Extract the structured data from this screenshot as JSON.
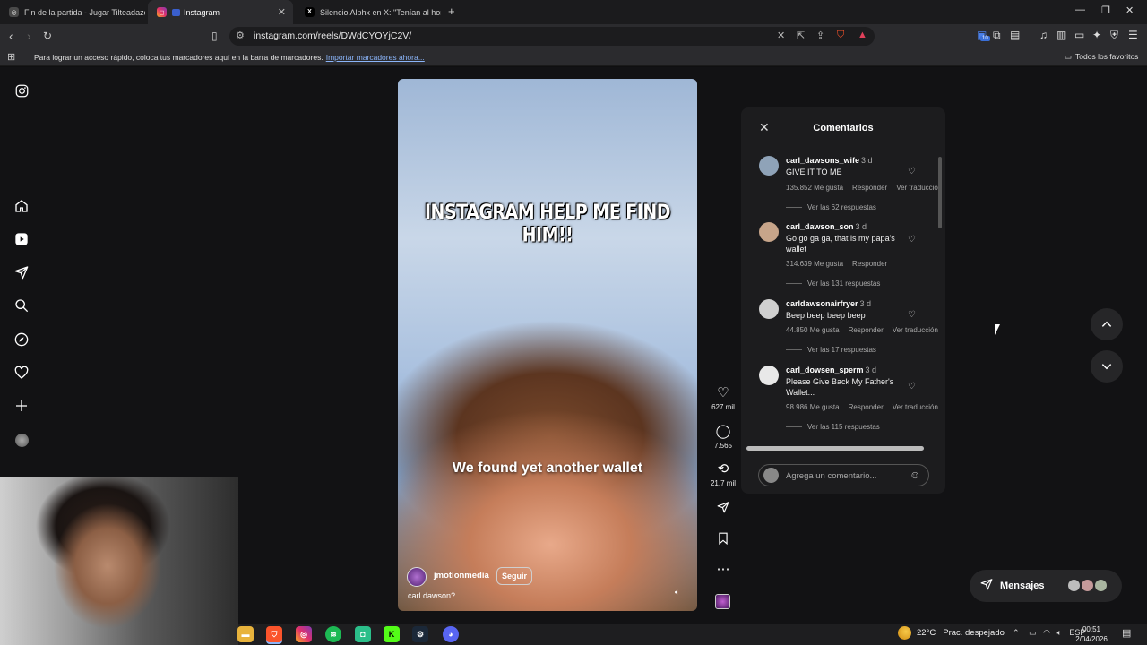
{
  "browser": {
    "tabs": [
      {
        "title": "Fin de la partida - Jugar Tilteadazo -",
        "active": false
      },
      {
        "title": "Instagram",
        "active": true
      },
      {
        "title": "Silencio Alphx en X: \"Tenían al hombr",
        "active": false
      }
    ],
    "new_tab_label": "+",
    "url": "instagram.com/reels/DWdCYOYjC2V/",
    "bookmarks_bar": {
      "message": "Para lograr un acceso rápido, coloca tus marcadores aquí en la barra de marcadores.",
      "import_link": "Importar marcadores ahora...",
      "all_favorites": "Todos los favoritos"
    },
    "extension_badge": "10"
  },
  "reel": {
    "title_overlay": "INSTAGRAM HELP ME FIND HIM!!",
    "caption_overlay": "We found yet another wallet",
    "author": "jmotionmedia",
    "follow_label": "Seguir",
    "description": "carl dawson?",
    "likes": "627 mil",
    "comments": "7.565",
    "reposts": "21,7 mil"
  },
  "comments_panel": {
    "title": "Comentarios",
    "input_placeholder": "Agrega un comentario...",
    "items": [
      {
        "user": "carl_dawsons_wife",
        "age": "3 d",
        "text": "GIVE IT TO ME",
        "likes": "135.852 Me gusta",
        "reply": "Responder",
        "translate": "Ver traducción",
        "replies": "Ver las 62 respuestas",
        "avatar_color": "#8fa3b8"
      },
      {
        "user": "carl_dawson_son",
        "age": "3 d",
        "text": "Go go ga ga, that is my papa's wallet",
        "likes": "314.639 Me gusta",
        "reply": "Responder",
        "translate": "",
        "replies": "Ver las 131 respuestas",
        "avatar_color": "#c7a58a"
      },
      {
        "user": "carldawsonairfryer",
        "age": "3 d",
        "text": "Beep beep beep beep",
        "likes": "44.850 Me gusta",
        "reply": "Responder",
        "translate": "Ver traducción",
        "replies": "Ver las 17 respuestas",
        "avatar_color": "#d0d0d0"
      },
      {
        "user": "carl_dowsen_sperm",
        "age": "3 d",
        "text": "Please Give Back My Father's Wallet...",
        "likes": "98.986 Me gusta",
        "reply": "Responder",
        "translate": "Ver traducción",
        "replies": "Ver las 115 respuestas",
        "avatar_color": "#e8e8e8"
      }
    ]
  },
  "messages": {
    "label": "Mensajes"
  },
  "taskbar": {
    "weather_temp": "22°C",
    "weather_desc": "Prac. despejado",
    "language": "ESP",
    "time": "00:51",
    "date": "2/04/2026"
  },
  "icons": {
    "instagram_logo": "instagram-icon",
    "home": "home-icon",
    "reels": "reels-icon",
    "messages": "send-icon",
    "search": "search-icon",
    "explore": "compass-icon",
    "notifications": "heart-icon",
    "create": "plus-icon"
  }
}
